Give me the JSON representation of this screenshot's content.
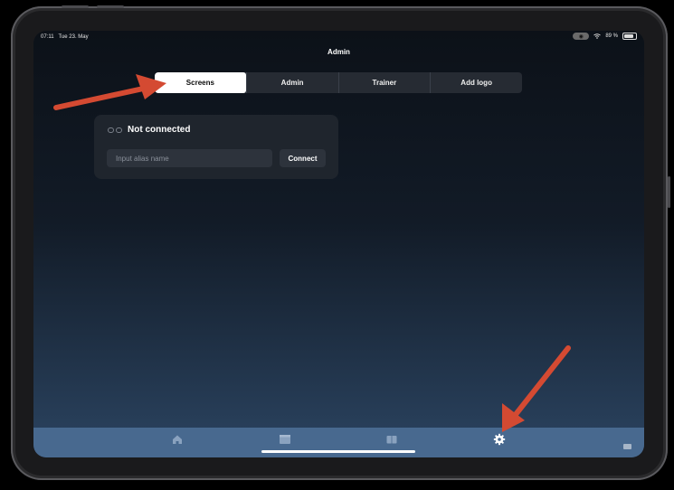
{
  "status_bar": {
    "time": "07:11",
    "date": "Tue 23. May",
    "battery": "89 %"
  },
  "header": {
    "title": "Admin"
  },
  "tabs": [
    {
      "label": "Screens",
      "active": true
    },
    {
      "label": "Admin",
      "active": false
    },
    {
      "label": "Trainer",
      "active": false
    },
    {
      "label": "Add logo",
      "active": false
    }
  ],
  "connection_card": {
    "status": "Not connected",
    "input_placeholder": "Input alias name",
    "connect_label": "Connect"
  },
  "tab_bar": {
    "items": [
      {
        "icon": "home-icon"
      },
      {
        "icon": "calendar-icon"
      },
      {
        "icon": "book-icon"
      },
      {
        "icon": "gear-icon",
        "active": true
      }
    ]
  },
  "annotation_color": "#d44a32"
}
